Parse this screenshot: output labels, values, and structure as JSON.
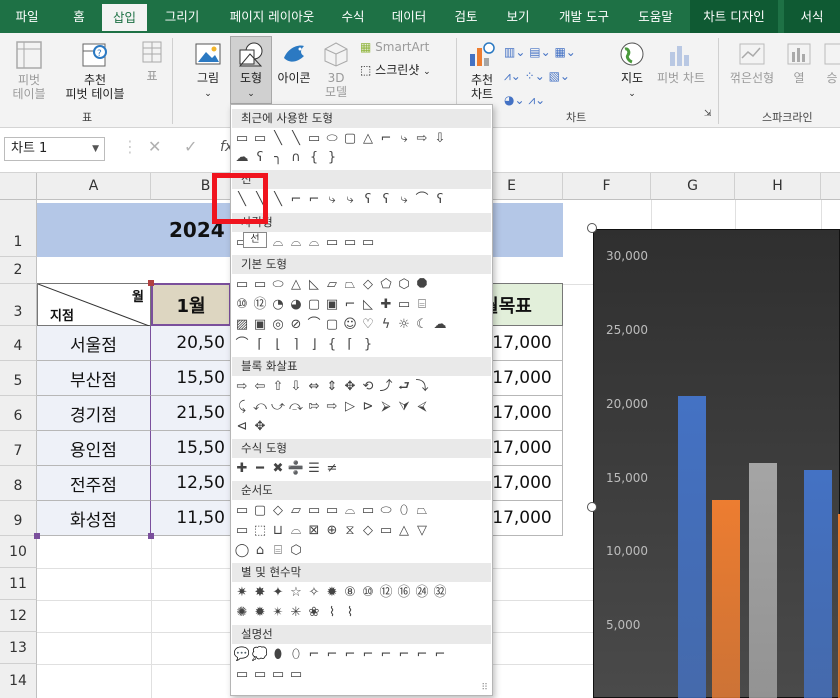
{
  "tabs": [
    "파일",
    "홈",
    "삽입",
    "그리기",
    "페이지 레이아웃",
    "수식",
    "데이터",
    "검토",
    "보기",
    "개발 도구",
    "도움말",
    "차트 디자인",
    "서식"
  ],
  "ribbon": {
    "pivot": "피벗\n테이블",
    "recommended_pivot": "추천\n피벗 테이블",
    "table": "표",
    "picture": "그림",
    "shapes": "도형",
    "icons": "아이콘",
    "model3d": "3D\n모델",
    "smartart": "SmartArt",
    "screenshot": "스크린샷",
    "rec_chart": "추천\n차트",
    "map": "지도",
    "pivot_chart": "피벗 차트",
    "line": "꺾은선형",
    "column": "열",
    "winloss": "승",
    "group_table": "표",
    "group_chart": "차트",
    "group_sparkline": "스파크라인"
  },
  "formula_bar": {
    "name_box": "차트 1",
    "cancel": "✕",
    "enter": "✓",
    "fx": "fx"
  },
  "columns": [
    "A",
    "B",
    "E",
    "F",
    "G",
    "H"
  ],
  "rows": [
    "1",
    "2",
    "3",
    "4",
    "5",
    "6",
    "7",
    "8",
    "9",
    "10",
    "11",
    "12",
    "13",
    "14"
  ],
  "sheet": {
    "title": "2024",
    "header_month": "월",
    "header_store": "지점",
    "header_jan": "1월",
    "header_target": "월목표",
    "stores": [
      "서울점",
      "부산점",
      "경기점",
      "용인점",
      "전주점",
      "화성점"
    ],
    "jan_values": [
      "20,50",
      "15,50",
      "21,50",
      "15,50",
      "12,50",
      "11,50"
    ],
    "targets": [
      "17,000",
      "17,000",
      "17,000",
      "17,000",
      "17,000",
      "17,000"
    ]
  },
  "chart_data": {
    "type": "bar",
    "y_ticks": [
      "30,000",
      "25,000",
      "20,000",
      "15,000",
      "10,000",
      "5,000"
    ],
    "ylim": [
      0,
      30000
    ],
    "series": [
      {
        "values": [
          20500,
          15500
        ]
      },
      {
        "values": [
          13500
        ]
      },
      {
        "values": [
          16000
        ]
      }
    ],
    "colors": {
      "blue": "#4472c4",
      "orange": "#ed7d31",
      "gray": "#a5a5a5"
    },
    "visible_bar_values": [
      20500,
      13500,
      16000,
      15500,
      12500
    ]
  },
  "menu": {
    "recent": "최근에 사용한 도형",
    "lines": "선",
    "rectangles": "사각형",
    "basic": "기본 도형",
    "block_arrows": "블록 화살표",
    "equation": "수식 도형",
    "flowchart": "순서도",
    "stars": "별 및 현수막",
    "callouts": "설명선",
    "tooltip": "선"
  },
  "shape_rows": {
    "recent1": "▭▭╲╲▭⬭▢△⌐⤷⇨⇩",
    "recent2": "☁ʕ╮∩{}",
    "lines": "╲╲╲⌐⌐⤷⤷ʕʕ⤷⌒ʕ",
    "rects": "▭▭⌓⌓⌓▭▭▭",
    "basic1": "▭▭⬭△◺▱⏢◇⬠⬡⯃",
    "basic2": "⑩⑫◔◕▢▣⌐◺✚▭⌸",
    "basic3": "▨▣◎⊘⌒▢☺♡ϟ☼☾☁",
    "basic4": "⌒⌈⌊⌉⌋{⌈}",
    "arrows1": "⇨⇦⇧⇩⇔⇕✥⟲⤴⮐⤵",
    "arrows2": "⤹⤺⤻⤼⇰⇨▷⊳⮚⮛⮘",
    "arrows3": "⊲✥",
    "eq": "✚━✖➗☰≠",
    "flow1": "▭▢◇▱▭▭⌓▭⬭⬯⏢",
    "flow2": "▭⬚⊔⌓⊠⊕⧖◇▭△▽",
    "flow3": "◯⌂⌸⬡",
    "stars1": "✷✸✦☆✧✹⑧⑩⑫⑯㉔㉜",
    "stars2": "✺✹✴✳❀⌇⌇",
    "call1": "💬💭⬮⬯⌐⌐⌐⌐⌐⌐⌐⌐",
    "call2": "▭▭▭▭"
  }
}
